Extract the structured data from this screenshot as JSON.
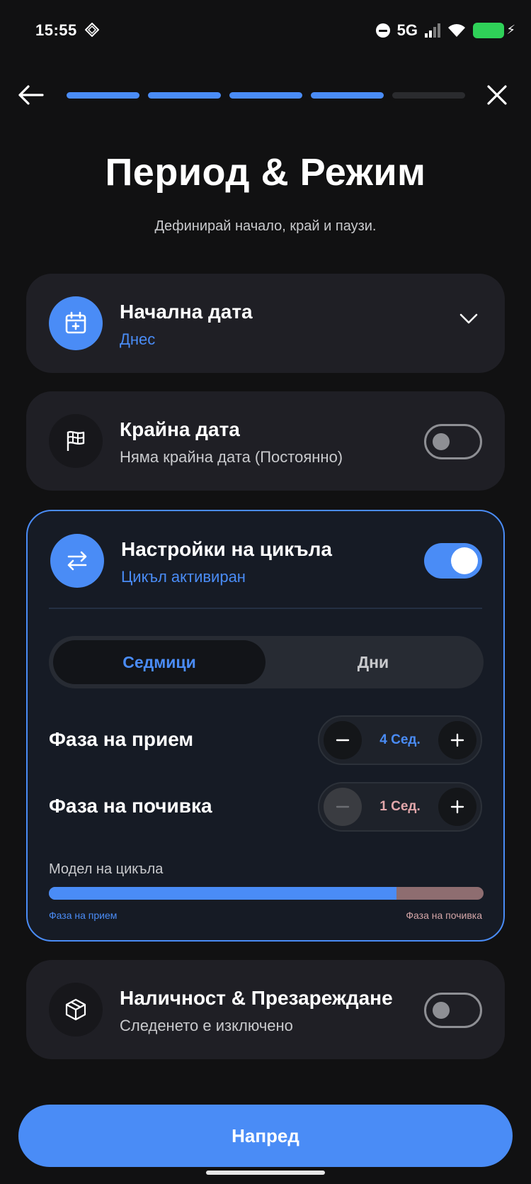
{
  "status_bar": {
    "time": "15:55",
    "network": "5G"
  },
  "header": {
    "progress_total": 5,
    "progress_done": 4,
    "title": "Период & Режим",
    "subtitle": "Дефинирай начало, край и паузи."
  },
  "start_date": {
    "title": "Начална дата",
    "value": "Днес"
  },
  "end_date": {
    "title": "Крайна дата",
    "value": "Няма крайна дата (Постоянно)",
    "enabled": false
  },
  "cycle": {
    "title": "Настройки на цикъла",
    "status": "Цикъл активиран",
    "enabled": true,
    "tabs": [
      "Седмици",
      "Дни"
    ],
    "selected_tab": "Седмици",
    "intake_label": "Фаза на прием",
    "intake_value": "4 Сед.",
    "rest_label": "Фаза на почивка",
    "rest_value": "1 Сед.",
    "model_label": "Модел на цикъла",
    "model_fraction_intake": 0.8,
    "legend_intake": "Фаза на прием",
    "legend_rest": "Фаза на почивка"
  },
  "stock": {
    "title": "Наличност & Презареждане",
    "status": "Следенето е изключено",
    "enabled": false
  },
  "footer": {
    "next_label": "Напред"
  },
  "colors": {
    "accent": "#4a8cf6",
    "background": "#111112",
    "card": "#1f1f25",
    "rest": "#8e6d70"
  }
}
